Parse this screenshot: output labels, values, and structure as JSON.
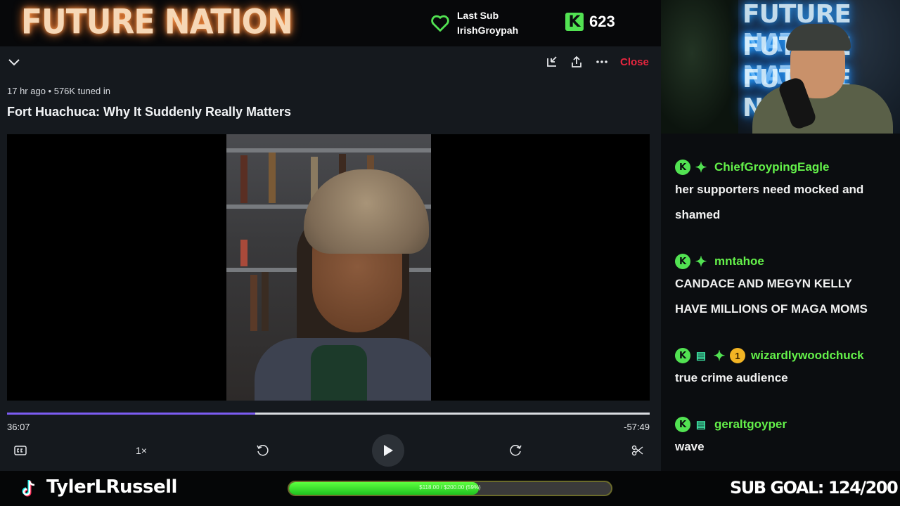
{
  "overlay": {
    "brand": "FUTURE NATION",
    "last_sub_label": "Last Sub",
    "last_sub_user": "IrishGroypah",
    "kick_count": "623",
    "kick_glyph": "K",
    "streamer": "TylerLRussell",
    "goal_text": "$118.00 / $200.00 (59%)",
    "goal_fraction": 0.59,
    "sub_goal": "SUB GOAL: 124/200",
    "cam_text_lines": [
      "FUTURE NATION",
      "FUTURE NATION",
      "FUTURE NATION"
    ],
    "colors": {
      "kick_green": "#52e252",
      "close_red": "#e8263f",
      "progress_purple": "#7c5cf2"
    }
  },
  "player": {
    "meta": "17 hr ago • 576K tuned in",
    "title": "Fort Huachuca: Why It Suddenly Really Matters",
    "close_label": "Close",
    "elapsed": "36:07",
    "remaining": "-57:49",
    "progress_fraction": 0.386,
    "speed_label": "1×",
    "icons": [
      "chevron-down-icon",
      "minimize-icon",
      "share-icon",
      "more-icon",
      "captions-icon",
      "rewind-15-icon",
      "play-icon",
      "forward-15-icon",
      "clip-icon"
    ]
  },
  "chat": {
    "messages": [
      {
        "user": "ChiefGroypingEagle",
        "lines": [
          "her supporters need mocked and",
          "shamed"
        ]
      },
      {
        "user": "mntahoe",
        "lines": [
          "CANDACE AND MEGYN KELLY",
          "HAVE MILLIONS OF MAGA MOMS"
        ]
      },
      {
        "user": "wizardlywoodchuck",
        "badge_number": "1",
        "lines": [
          "true crime audience"
        ]
      },
      {
        "user": "geraltgoyper",
        "lines": [
          "wave"
        ]
      }
    ]
  }
}
